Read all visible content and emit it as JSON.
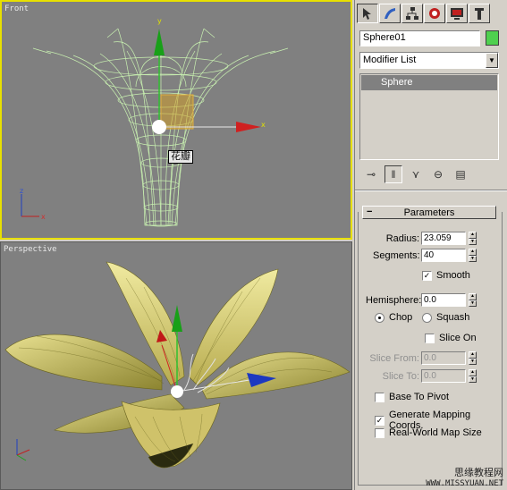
{
  "viewports": {
    "front": {
      "label": "Front",
      "tag": "花瓣",
      "axis_labels": {
        "x": "x",
        "y": "y",
        "z": "z"
      }
    },
    "perspective": {
      "label": "Perspective"
    }
  },
  "command_panel": {
    "tabs": [
      {
        "icon": "create-icon"
      },
      {
        "icon": "modify-icon"
      },
      {
        "icon": "hierarchy-icon"
      },
      {
        "icon": "motion-icon"
      },
      {
        "icon": "display-icon"
      },
      {
        "icon": "utilities-icon"
      }
    ],
    "object_name": "Sphere01",
    "object_color": "#4fd04f",
    "modifier_list": "Modifier List",
    "stack": [
      "Sphere"
    ],
    "parameters": {
      "rollout_title": "Parameters",
      "radius_label": "Radius:",
      "radius_value": "23.059",
      "segments_label": "Segments:",
      "segments_value": "40",
      "smooth_label": "Smooth",
      "smooth_checked": true,
      "hemisphere_label": "Hemisphere:",
      "hemisphere_value": "0.0",
      "chop_label": "Chop",
      "squash_label": "Squash",
      "chop_selected": true,
      "slice_on_label": "Slice On",
      "slice_from_label": "Slice From:",
      "slice_from_value": "0.0",
      "slice_to_label": "Slice To:",
      "slice_to_value": "0.0",
      "base_to_pivot_label": "Base To Pivot",
      "gen_mapping_label": "Generate Mapping Coords.",
      "real_world_label": "Real-World Map Size"
    }
  },
  "watermark": {
    "line1": "思缘教程网",
    "line2": "WWW.MISSYUAN.NET"
  }
}
